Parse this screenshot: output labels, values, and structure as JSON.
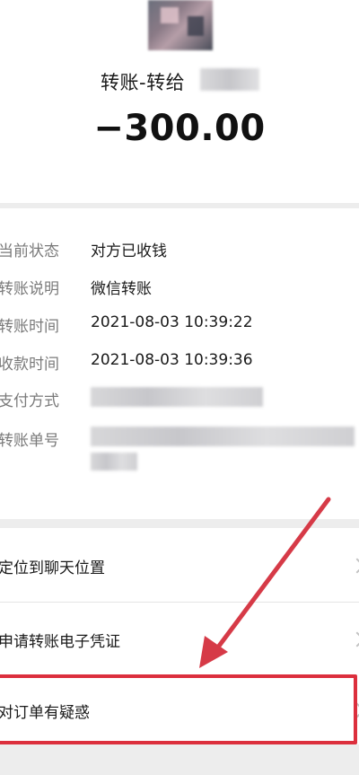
{
  "header": {
    "title_prefix": "转账-转给",
    "amount": "−300.00"
  },
  "details": [
    {
      "label": "当前状态",
      "value": "对方已收钱"
    },
    {
      "label": "转账说明",
      "value": "微信转账"
    },
    {
      "label": "转账时间",
      "value": "2021-08-03 10:39:22"
    },
    {
      "label": "收款时间",
      "value": "2021-08-03 10:39:36"
    },
    {
      "label": "支付方式",
      "value": ""
    },
    {
      "label": "转账单号",
      "value": ""
    }
  ],
  "actions": [
    {
      "label": "定位到聊天位置"
    },
    {
      "label": "申请转账电子凭证"
    },
    {
      "label": "对订单有疑惑"
    }
  ],
  "colors": {
    "highlight": "#dc2f3d",
    "arrow": "#d63a47",
    "background": "#ededed"
  },
  "icons": {
    "row_chevron": "chevron-right-icon",
    "annotation": "red-arrow-annotation"
  }
}
